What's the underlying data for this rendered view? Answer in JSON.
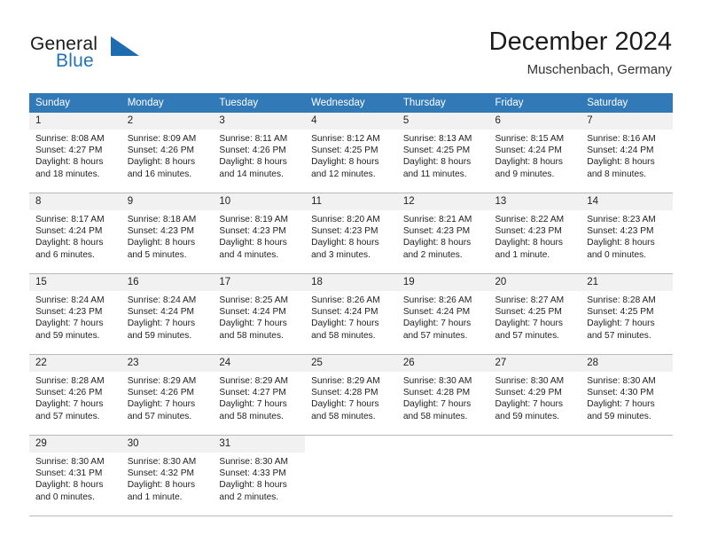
{
  "brand": {
    "line1": "General",
    "line2": "Blue",
    "accent_color": "#1d6cb0"
  },
  "header": {
    "title": "December 2024",
    "subtitle": "Muschenbach, Germany"
  },
  "calendar": {
    "header_color": "#3279b8",
    "weekday_headers": [
      "Sunday",
      "Monday",
      "Tuesday",
      "Wednesday",
      "Thursday",
      "Friday",
      "Saturday"
    ],
    "weeks": [
      [
        {
          "day": "1",
          "sunrise": "Sunrise: 8:08 AM",
          "sunset": "Sunset: 4:27 PM",
          "daylight_line1": "Daylight: 8 hours",
          "daylight_line2": "and 18 minutes."
        },
        {
          "day": "2",
          "sunrise": "Sunrise: 8:09 AM",
          "sunset": "Sunset: 4:26 PM",
          "daylight_line1": "Daylight: 8 hours",
          "daylight_line2": "and 16 minutes."
        },
        {
          "day": "3",
          "sunrise": "Sunrise: 8:11 AM",
          "sunset": "Sunset: 4:26 PM",
          "daylight_line1": "Daylight: 8 hours",
          "daylight_line2": "and 14 minutes."
        },
        {
          "day": "4",
          "sunrise": "Sunrise: 8:12 AM",
          "sunset": "Sunset: 4:25 PM",
          "daylight_line1": "Daylight: 8 hours",
          "daylight_line2": "and 12 minutes."
        },
        {
          "day": "5",
          "sunrise": "Sunrise: 8:13 AM",
          "sunset": "Sunset: 4:25 PM",
          "daylight_line1": "Daylight: 8 hours",
          "daylight_line2": "and 11 minutes."
        },
        {
          "day": "6",
          "sunrise": "Sunrise: 8:15 AM",
          "sunset": "Sunset: 4:24 PM",
          "daylight_line1": "Daylight: 8 hours",
          "daylight_line2": "and 9 minutes."
        },
        {
          "day": "7",
          "sunrise": "Sunrise: 8:16 AM",
          "sunset": "Sunset: 4:24 PM",
          "daylight_line1": "Daylight: 8 hours",
          "daylight_line2": "and 8 minutes."
        }
      ],
      [
        {
          "day": "8",
          "sunrise": "Sunrise: 8:17 AM",
          "sunset": "Sunset: 4:24 PM",
          "daylight_line1": "Daylight: 8 hours",
          "daylight_line2": "and 6 minutes."
        },
        {
          "day": "9",
          "sunrise": "Sunrise: 8:18 AM",
          "sunset": "Sunset: 4:23 PM",
          "daylight_line1": "Daylight: 8 hours",
          "daylight_line2": "and 5 minutes."
        },
        {
          "day": "10",
          "sunrise": "Sunrise: 8:19 AM",
          "sunset": "Sunset: 4:23 PM",
          "daylight_line1": "Daylight: 8 hours",
          "daylight_line2": "and 4 minutes."
        },
        {
          "day": "11",
          "sunrise": "Sunrise: 8:20 AM",
          "sunset": "Sunset: 4:23 PM",
          "daylight_line1": "Daylight: 8 hours",
          "daylight_line2": "and 3 minutes."
        },
        {
          "day": "12",
          "sunrise": "Sunrise: 8:21 AM",
          "sunset": "Sunset: 4:23 PM",
          "daylight_line1": "Daylight: 8 hours",
          "daylight_line2": "and 2 minutes."
        },
        {
          "day": "13",
          "sunrise": "Sunrise: 8:22 AM",
          "sunset": "Sunset: 4:23 PM",
          "daylight_line1": "Daylight: 8 hours",
          "daylight_line2": "and 1 minute."
        },
        {
          "day": "14",
          "sunrise": "Sunrise: 8:23 AM",
          "sunset": "Sunset: 4:23 PM",
          "daylight_line1": "Daylight: 8 hours",
          "daylight_line2": "and 0 minutes."
        }
      ],
      [
        {
          "day": "15",
          "sunrise": "Sunrise: 8:24 AM",
          "sunset": "Sunset: 4:23 PM",
          "daylight_line1": "Daylight: 7 hours",
          "daylight_line2": "and 59 minutes."
        },
        {
          "day": "16",
          "sunrise": "Sunrise: 8:24 AM",
          "sunset": "Sunset: 4:24 PM",
          "daylight_line1": "Daylight: 7 hours",
          "daylight_line2": "and 59 minutes."
        },
        {
          "day": "17",
          "sunrise": "Sunrise: 8:25 AM",
          "sunset": "Sunset: 4:24 PM",
          "daylight_line1": "Daylight: 7 hours",
          "daylight_line2": "and 58 minutes."
        },
        {
          "day": "18",
          "sunrise": "Sunrise: 8:26 AM",
          "sunset": "Sunset: 4:24 PM",
          "daylight_line1": "Daylight: 7 hours",
          "daylight_line2": "and 58 minutes."
        },
        {
          "day": "19",
          "sunrise": "Sunrise: 8:26 AM",
          "sunset": "Sunset: 4:24 PM",
          "daylight_line1": "Daylight: 7 hours",
          "daylight_line2": "and 57 minutes."
        },
        {
          "day": "20",
          "sunrise": "Sunrise: 8:27 AM",
          "sunset": "Sunset: 4:25 PM",
          "daylight_line1": "Daylight: 7 hours",
          "daylight_line2": "and 57 minutes."
        },
        {
          "day": "21",
          "sunrise": "Sunrise: 8:28 AM",
          "sunset": "Sunset: 4:25 PM",
          "daylight_line1": "Daylight: 7 hours",
          "daylight_line2": "and 57 minutes."
        }
      ],
      [
        {
          "day": "22",
          "sunrise": "Sunrise: 8:28 AM",
          "sunset": "Sunset: 4:26 PM",
          "daylight_line1": "Daylight: 7 hours",
          "daylight_line2": "and 57 minutes."
        },
        {
          "day": "23",
          "sunrise": "Sunrise: 8:29 AM",
          "sunset": "Sunset: 4:26 PM",
          "daylight_line1": "Daylight: 7 hours",
          "daylight_line2": "and 57 minutes."
        },
        {
          "day": "24",
          "sunrise": "Sunrise: 8:29 AM",
          "sunset": "Sunset: 4:27 PM",
          "daylight_line1": "Daylight: 7 hours",
          "daylight_line2": "and 58 minutes."
        },
        {
          "day": "25",
          "sunrise": "Sunrise: 8:29 AM",
          "sunset": "Sunset: 4:28 PM",
          "daylight_line1": "Daylight: 7 hours",
          "daylight_line2": "and 58 minutes."
        },
        {
          "day": "26",
          "sunrise": "Sunrise: 8:30 AM",
          "sunset": "Sunset: 4:28 PM",
          "daylight_line1": "Daylight: 7 hours",
          "daylight_line2": "and 58 minutes."
        },
        {
          "day": "27",
          "sunrise": "Sunrise: 8:30 AM",
          "sunset": "Sunset: 4:29 PM",
          "daylight_line1": "Daylight: 7 hours",
          "daylight_line2": "and 59 minutes."
        },
        {
          "day": "28",
          "sunrise": "Sunrise: 8:30 AM",
          "sunset": "Sunset: 4:30 PM",
          "daylight_line1": "Daylight: 7 hours",
          "daylight_line2": "and 59 minutes."
        }
      ],
      [
        {
          "day": "29",
          "sunrise": "Sunrise: 8:30 AM",
          "sunset": "Sunset: 4:31 PM",
          "daylight_line1": "Daylight: 8 hours",
          "daylight_line2": "and 0 minutes."
        },
        {
          "day": "30",
          "sunrise": "Sunrise: 8:30 AM",
          "sunset": "Sunset: 4:32 PM",
          "daylight_line1": "Daylight: 8 hours",
          "daylight_line2": "and 1 minute."
        },
        {
          "day": "31",
          "sunrise": "Sunrise: 8:30 AM",
          "sunset": "Sunset: 4:33 PM",
          "daylight_line1": "Daylight: 8 hours",
          "daylight_line2": "and 2 minutes."
        },
        {
          "day": "",
          "sunrise": "",
          "sunset": "",
          "daylight_line1": "",
          "daylight_line2": ""
        },
        {
          "day": "",
          "sunrise": "",
          "sunset": "",
          "daylight_line1": "",
          "daylight_line2": ""
        },
        {
          "day": "",
          "sunrise": "",
          "sunset": "",
          "daylight_line1": "",
          "daylight_line2": ""
        },
        {
          "day": "",
          "sunrise": "",
          "sunset": "",
          "daylight_line1": "",
          "daylight_line2": ""
        }
      ]
    ]
  }
}
